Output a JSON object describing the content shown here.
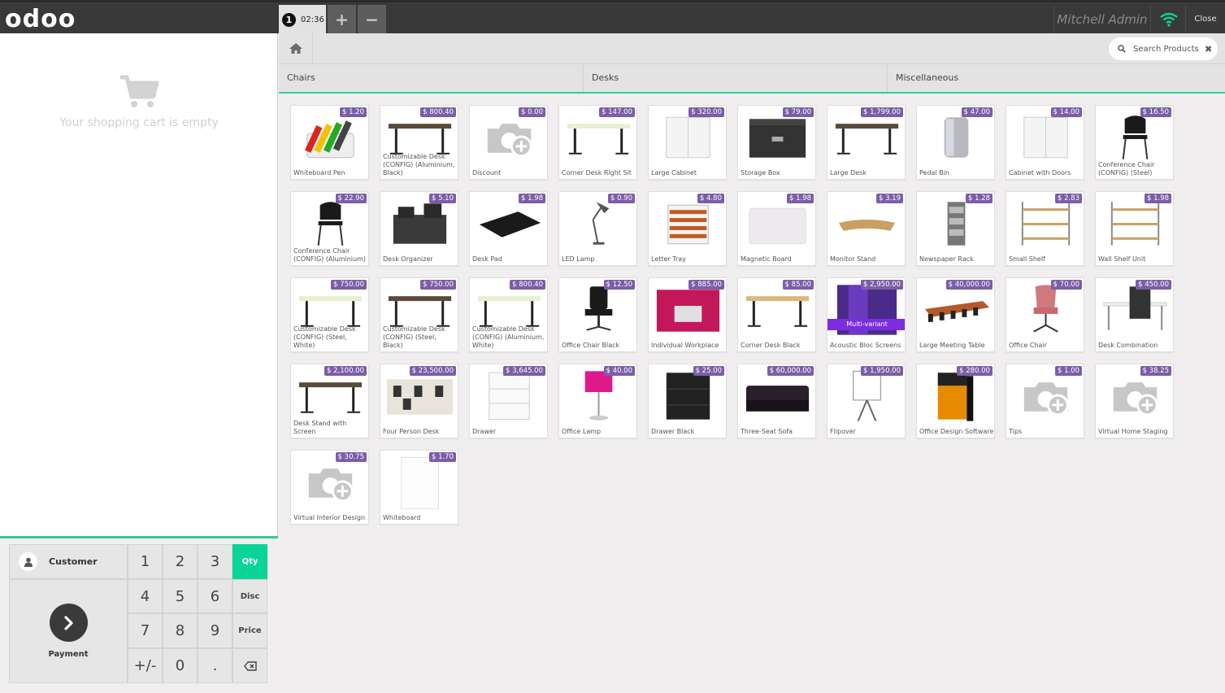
{
  "header": {
    "logo": "odoo",
    "order_number": "1",
    "order_time": "02:36",
    "add_order": "+",
    "remove_order": "−",
    "user": "Mitchell Admin",
    "close": "Close",
    "wifi_color": "#0bd499"
  },
  "cart": {
    "empty_text": "Your shopping cart is empty"
  },
  "pad": {
    "customer": "Customer",
    "payment": "Payment",
    "keys": [
      "1",
      "2",
      "3",
      "Qty",
      "4",
      "5",
      "6",
      "Disc",
      "7",
      "8",
      "9",
      "Price",
      "+/-",
      "0",
      ".",
      "⌫"
    ],
    "active_mode": "Qty",
    "accent": "#0bd499"
  },
  "search": {
    "placeholder": "Search Products"
  },
  "categories": [
    "Chairs",
    "Desks",
    "Miscellaneous"
  ],
  "products": [
    {
      "name": "Whiteboard Pen",
      "price": "$ 1.20",
      "img": "pens"
    },
    {
      "name": "Customizable Desk (CONFIG) (Aluminium, Black)",
      "price": "$ 800.40",
      "img": "desk-dark"
    },
    {
      "name": "Discount",
      "price": "$ 0.00",
      "img": "placeholder"
    },
    {
      "name": "Corner Desk Right Sit",
      "price": "$ 147.00",
      "img": "desk-light"
    },
    {
      "name": "Large Cabinet",
      "price": "$ 320.00",
      "img": "cabinet"
    },
    {
      "name": "Storage Box",
      "price": "$ 79.00",
      "img": "box"
    },
    {
      "name": "Large Desk",
      "price": "$ 1,799.00",
      "img": "desk-dark"
    },
    {
      "name": "Pedal Bin",
      "price": "$ 47.00",
      "img": "bin"
    },
    {
      "name": "Cabinet with Doors",
      "price": "$ 14.00",
      "img": "cabinet"
    },
    {
      "name": "Conference Chair (CONFIG) (Steel)",
      "price": "$ 16.50",
      "img": "chair"
    },
    {
      "name": "Conference Chair (CONFIG) (Aluminium)",
      "price": "$ 22.90",
      "img": "chair"
    },
    {
      "name": "Desk Organizer",
      "price": "$ 5.10",
      "img": "organizer"
    },
    {
      "name": "Desk Pad",
      "price": "$ 1.98",
      "img": "pad"
    },
    {
      "name": "LED Lamp",
      "price": "$ 0.90",
      "img": "lamp"
    },
    {
      "name": "Letter Tray",
      "price": "$ 4.80",
      "img": "tray"
    },
    {
      "name": "Magnetic Board",
      "price": "$ 1.98",
      "img": "board"
    },
    {
      "name": "Monitor Stand",
      "price": "$ 3.19",
      "img": "stand"
    },
    {
      "name": "Newspaper Rack",
      "price": "$ 1.28",
      "img": "rack"
    },
    {
      "name": "Small Shelf",
      "price": "$ 2.83",
      "img": "shelf"
    },
    {
      "name": "Wall Shelf Unit",
      "price": "$ 1.98",
      "img": "shelf"
    },
    {
      "name": "Customizable Desk (CONFIG) (Steel, White)",
      "price": "$ 750.00",
      "img": "desk-light"
    },
    {
      "name": "Customizable Desk (CONFIG) (Steel, Black)",
      "price": "$ 750.00",
      "img": "desk-dark"
    },
    {
      "name": "Customizable Desk (CONFIG) (Aluminium, White)",
      "price": "$ 800.40",
      "img": "desk-light"
    },
    {
      "name": "Office Chair Black",
      "price": "$ 12.50",
      "img": "office-chair"
    },
    {
      "name": "Individual Workplace",
      "price": "$ 885.00",
      "img": "workplace"
    },
    {
      "name": "Corner Desk Black",
      "price": "$ 85.00",
      "img": "desk-wood"
    },
    {
      "name": "Acoustic Bloc Screens",
      "price": "$ 2,950.00",
      "img": "screens",
      "badge": "Multi-variant"
    },
    {
      "name": "Large Meeting Table",
      "price": "$ 40,000.00",
      "img": "meeting"
    },
    {
      "name": "Office Chair",
      "price": "$ 70.00",
      "img": "pink-chair"
    },
    {
      "name": "Desk Combination",
      "price": "$ 450.00",
      "img": "combo"
    },
    {
      "name": "Desk Stand with Screen",
      "price": "$ 2,100.00",
      "img": "desk-dark"
    },
    {
      "name": "Four Person Desk",
      "price": "$ 23,500.00",
      "img": "four-desk"
    },
    {
      "name": "Drawer",
      "price": "$ 3,645.00",
      "img": "drawer"
    },
    {
      "name": "Office Lamp",
      "price": "$ 40.00",
      "img": "pink-lamp"
    },
    {
      "name": "Drawer Black",
      "price": "$ 25.00",
      "img": "drawer-black"
    },
    {
      "name": "Three-Seat Sofa",
      "price": "$ 60,000.00",
      "img": "sofa"
    },
    {
      "name": "Flipover",
      "price": "$ 1,950.00",
      "img": "flipover"
    },
    {
      "name": "Office Design Software",
      "price": "$ 280.00",
      "img": "software"
    },
    {
      "name": "Tips",
      "price": "$ 1.00",
      "img": "placeholder"
    },
    {
      "name": "Virtual Home Staging",
      "price": "$ 38.25",
      "img": "placeholder"
    },
    {
      "name": "Virtual Interior Design",
      "price": "$ 30.75",
      "img": "placeholder"
    },
    {
      "name": "Whiteboard",
      "price": "$ 1.70",
      "img": "whiteboard"
    }
  ]
}
